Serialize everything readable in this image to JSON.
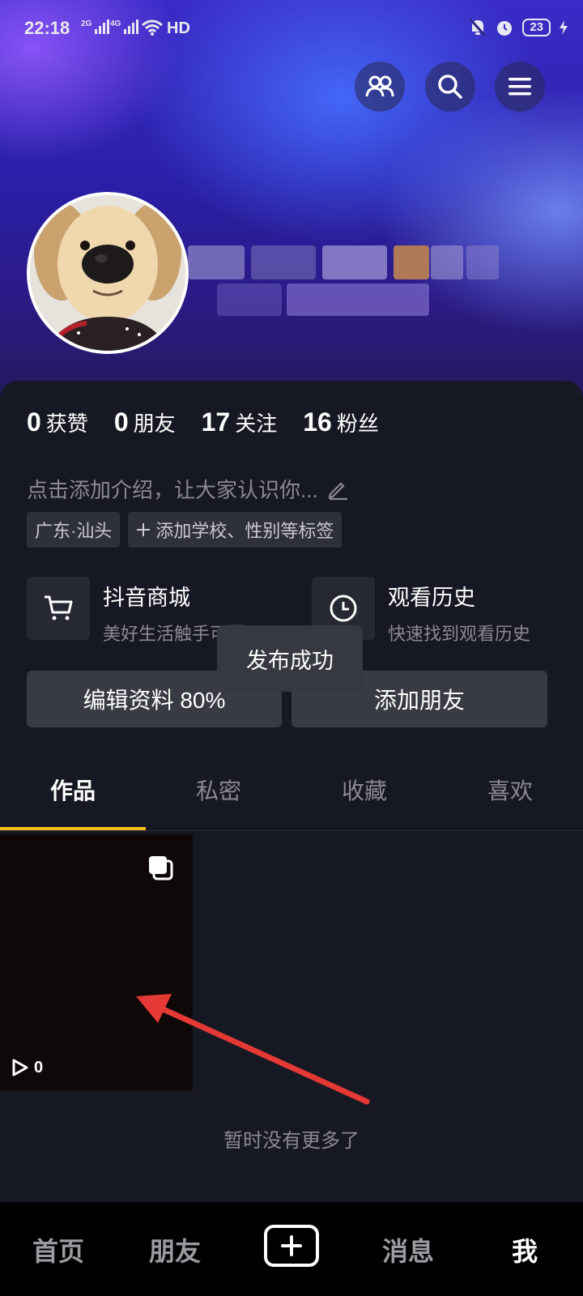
{
  "status_bar": {
    "time": "22:18",
    "signal1_label": "2G",
    "signal2_label": "4G",
    "network": "HD",
    "battery": "23"
  },
  "top_actions": {
    "friends_icon": "people-icon",
    "search_icon": "search-icon",
    "menu_icon": "menu-icon"
  },
  "stats": [
    {
      "num": "0",
      "label": "获赞"
    },
    {
      "num": "0",
      "label": "朋友"
    },
    {
      "num": "17",
      "label": "关注"
    },
    {
      "num": "16",
      "label": "粉丝"
    }
  ],
  "bio": "点击添加介绍，让大家认识你...",
  "tags": {
    "location": "广东·汕头",
    "add_tag": "添加学校、性别等标签"
  },
  "entries": {
    "mall_title": "抖音商城",
    "mall_sub": "美好生活触手可得",
    "history_title": "观看历史",
    "history_sub": "快速找到观看历史"
  },
  "buttons": {
    "edit_profile": "编辑资料 80%",
    "add_friend": "添加朋友"
  },
  "toast": "发布成功",
  "tabs": [
    "作品",
    "私密",
    "收藏",
    "喜欢"
  ],
  "video": {
    "play_count": "0"
  },
  "no_more": "暂时没有更多了",
  "bottom_nav": {
    "home": "首页",
    "friends": "朋友",
    "messages": "消息",
    "me": "我"
  },
  "colors": {
    "accent_underline": "#f8c11c",
    "arrow": "#e53935"
  }
}
